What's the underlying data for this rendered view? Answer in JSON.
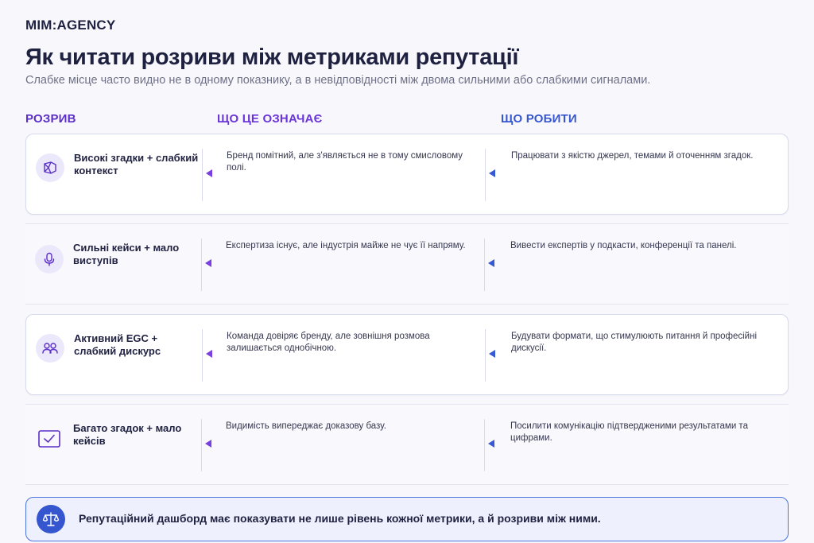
{
  "brand": "MIM:AGENCY",
  "title": "Як читати розриви між метриками репутації",
  "subtitle": "Слабке місце часто видно не в одному показнику, а в невідповідності між двома сильними або слабкими сигналами.",
  "columns": {
    "gap": "РОЗРИВ",
    "meaning": "ЩО ЦЕ ОЗНАЧАЄ",
    "action": "ЩО РОБИТИ"
  },
  "rows": [
    {
      "icon": "cube-icon",
      "gap": "Високі згадки + слабкий контекст",
      "meaning": "Бренд помітний, але з'являється не в тому смисловому полі.",
      "action": "Працювати з якістю джерел, темами й оточенням згадок."
    },
    {
      "icon": "microphone-icon",
      "gap": "Сильні кейси + мало виступів",
      "meaning": "Експертиза існує, але індустрія майже не чує її напряму.",
      "action": "Вивести експертів у подкасти, конференції та панелі."
    },
    {
      "icon": "users-icon",
      "gap": "Активний EGC + слабкий дискурс",
      "meaning": "Команда довіряє бренду, але зовнішня розмова залишається однобічною.",
      "action": "Будувати формати, що стимулюють питання й професійні дискусії."
    },
    {
      "icon": "checkbox-icon",
      "gap": "Багато згадок + мало кейсів",
      "meaning": "Видимість випереджає доказову базу.",
      "action": "Посилити комунікацію підтвердженими результатами та цифрами."
    }
  ],
  "footer": {
    "icon": "scales-icon",
    "text": "Репутаційний дашборд має показувати не лише рівень кожної метрики, а й розриви між ними."
  },
  "colors": {
    "accent_purple": "#6a35d9",
    "accent_blue": "#3656d0",
    "text_dark": "#1f2141"
  }
}
